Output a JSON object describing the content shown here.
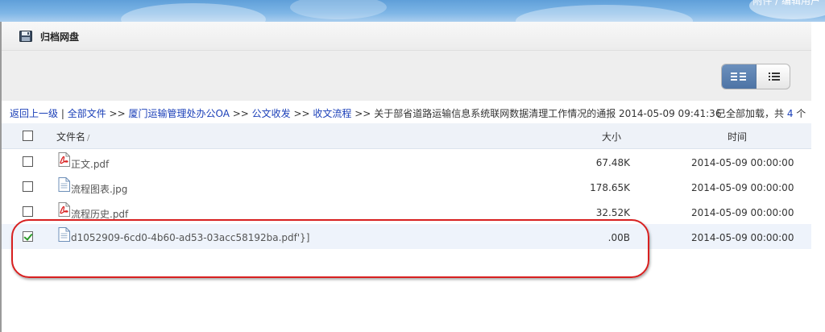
{
  "app": {
    "title": "归档网盘"
  },
  "banner": {
    "corner_text": "附件 / 编辑用户"
  },
  "toolbar": {
    "grid_view_icon": "grid-view-icon",
    "list_view_icon": "list-view-icon"
  },
  "breadcrumb": {
    "items": [
      {
        "label": "返回上一级",
        "link": true
      },
      {
        "label": " | ",
        "link": false
      },
      {
        "label": "全部文件",
        "link": true
      },
      {
        "label": " >> ",
        "link": false
      },
      {
        "label": "厦门运输管理处办公OA",
        "link": true
      },
      {
        "label": " >> ",
        "link": false
      },
      {
        "label": "公文收发",
        "link": true
      },
      {
        "label": " >> ",
        "link": false
      },
      {
        "label": "收文流程",
        "link": true
      },
      {
        "label": " >> ",
        "link": false
      },
      {
        "label": "关于部省道路运输信息系统联网数据清理工作情况的通报 2014-05-09 09:41:36",
        "link": false
      }
    ],
    "status_prefix": "已全部加载，共 ",
    "status_count": "4",
    "status_suffix": " 个"
  },
  "table": {
    "headers": {
      "name": "文件名",
      "sort_indicator": "/",
      "size": "大小",
      "time": "时间"
    },
    "rows": [
      {
        "name": "正文.pdf",
        "icon": "pdf-file-icon",
        "size": "67.48K",
        "time": "2014-05-09 00:00:00",
        "checked": false
      },
      {
        "name": "流程图表.jpg",
        "icon": "image-file-icon",
        "size": "178.65K",
        "time": "2014-05-09 00:00:00",
        "checked": false
      },
      {
        "name": "流程历史.pdf",
        "icon": "pdf-file-icon",
        "size": "32.52K",
        "time": "2014-05-09 00:00:00",
        "checked": false
      },
      {
        "name": "d1052909-6cd0-4b60-ad53-03acc58192ba.pdf'}]",
        "icon": "generic-file-icon",
        "size": ".00B",
        "time": "2014-05-09 00:00:00",
        "checked": true
      }
    ]
  },
  "colors": {
    "link": "#1a3fb8",
    "highlight_ring": "#d82020",
    "selected_row": "#eef3fb",
    "toggle_active": "#4e74a5"
  }
}
